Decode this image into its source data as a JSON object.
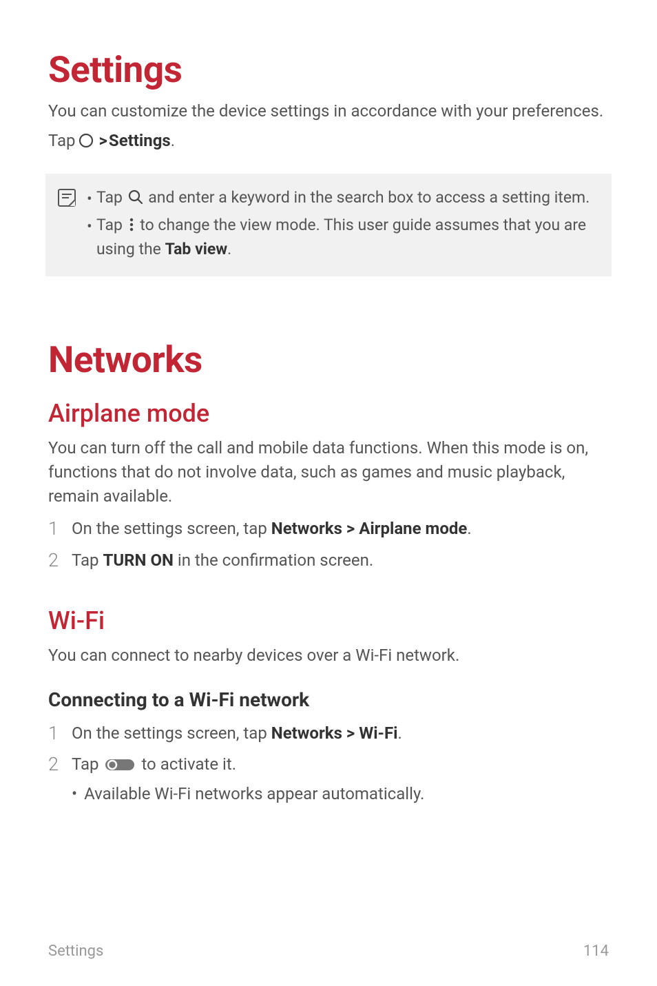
{
  "headings": {
    "settings": "Settings",
    "networks": "Networks",
    "airplane_mode": "Airplane mode",
    "wifi": "Wi-Fi",
    "connecting_wifi": "Connecting to a Wi-Fi network"
  },
  "paragraphs": {
    "settings_intro": "You can customize the device settings in accordance with your preferences.",
    "tap_prefix": "Tap ",
    "tap_gt": " ",
    "tap_settings_bold": "Settings",
    "tap_period": ".",
    "airplane_intro": "You can turn off the call and mobile data functions. When this mode is on, functions that do not involve data, such as games and music playback, remain available.",
    "wifi_intro": "You can connect to nearby devices over a Wi-Fi network."
  },
  "note": {
    "item1_pre": "Tap ",
    "item1_post": " and enter a keyword in the search box to access a setting item.",
    "item2_pre": "Tap ",
    "item2_mid": " to change the view mode. This user guide assumes that you are using the ",
    "item2_bold": "Tab view",
    "item2_end": "."
  },
  "airplane_steps": {
    "s1_pre": "On the settings screen, tap ",
    "s1_b1": "Networks",
    "s1_mid": " ",
    "s1_b2": "Airplane mode",
    "s1_end": ".",
    "s2_pre": "Tap ",
    "s2_b1": "TURN ON",
    "s2_end": " in the confirmation screen."
  },
  "wifi_steps": {
    "s1_pre": "On the settings screen, tap ",
    "s1_b1": "Networks",
    "s1_mid": " ",
    "s1_b2": "Wi-Fi",
    "s1_end": ".",
    "s2_pre": "Tap ",
    "s2_post": " to activate it.",
    "sub1": "Available Wi-Fi networks appear automatically."
  },
  "numbers": {
    "n1": "1",
    "n2": "2"
  },
  "footer": {
    "left": "Settings",
    "right": "114"
  },
  "glyphs": {
    "bullet": "•",
    "gt": ">"
  }
}
